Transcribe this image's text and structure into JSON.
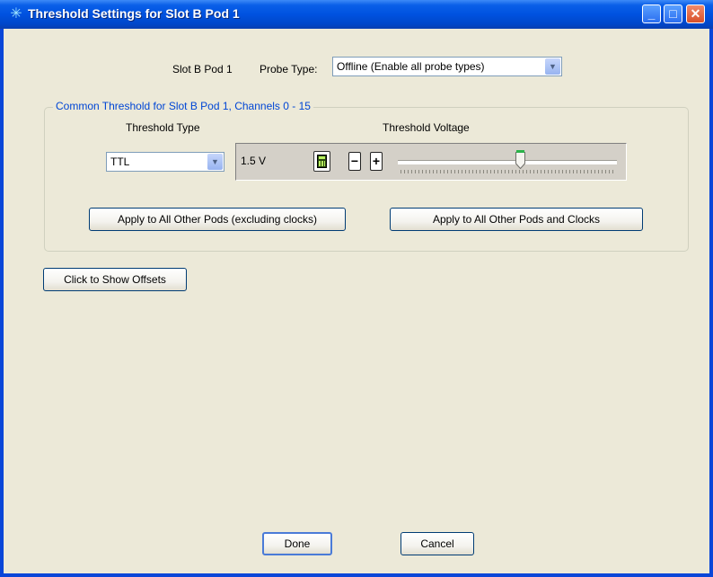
{
  "window": {
    "title": "Threshold Settings for Slot B Pod 1"
  },
  "header": {
    "slot_label": "Slot B Pod 1",
    "probe_type_label": "Probe Type:",
    "probe_type_value": "Offline (Enable all probe types)"
  },
  "common_threshold": {
    "group_title": "Common Threshold for Slot B Pod 1, Channels 0 - 15",
    "threshold_type_label": "Threshold Type",
    "threshold_voltage_label": "Threshold Voltage",
    "threshold_type_value": "TTL",
    "voltage_value": "1.5 V",
    "minus_label": "−",
    "plus_label": "+",
    "apply_excluding_clocks": "Apply to All Other Pods (excluding clocks)",
    "apply_including_clocks": "Apply to All Other Pods and Clocks"
  },
  "offsets_button": "Click to Show Offsets",
  "footer": {
    "done": "Done",
    "cancel": "Cancel"
  },
  "icons": {
    "app": "analyzer-star-icon",
    "calculator": "calculator-icon",
    "minimize": "minimize-icon",
    "maximize": "maximize-icon",
    "close": "close-icon"
  },
  "colors": {
    "titlebar": "#0052e0",
    "client_bg": "#ece9d8",
    "group_title": "#0046d5",
    "thumb_marker": "#2bb34a"
  }
}
